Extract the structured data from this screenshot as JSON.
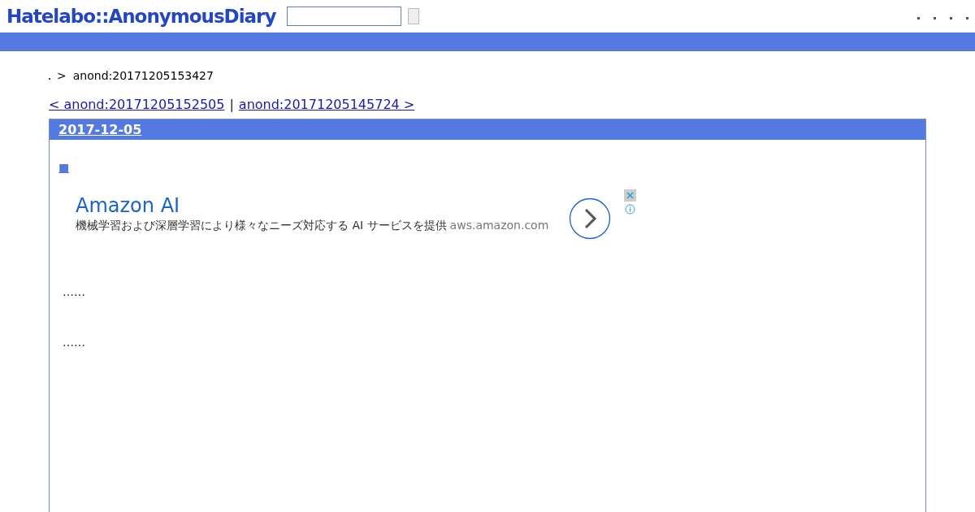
{
  "header": {
    "logo": "Hatelabo::AnonymousDiary"
  },
  "breadcrumb": {
    "separator": ">",
    "current": "anond:20171205153427"
  },
  "pager": {
    "prev": "< anond:20171205152505",
    "divider": "|",
    "next": "anond:20171205145724 >"
  },
  "day": {
    "date": "2017-12-05",
    "section_mark": "■",
    "ad": {
      "title": "Amazon AI",
      "text": "機械学習および深層学習により様々なニーズ対応する AI サービスを提供",
      "domain": "aws.amazon.com"
    },
    "paragraphs": [
      "……",
      "……"
    ]
  }
}
